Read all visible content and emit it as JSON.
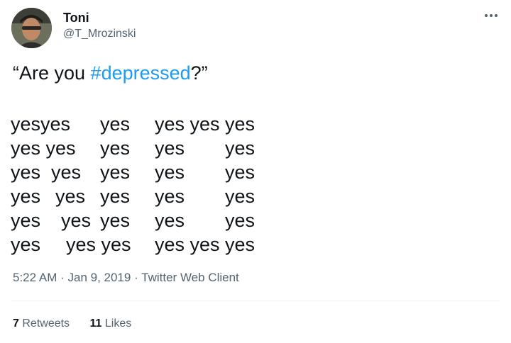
{
  "author": {
    "display_name": "Toni",
    "handle": "@T_Mrozinski"
  },
  "tweet": {
    "quote_open": "“Are you ",
    "hashtag": "#depressed",
    "quote_close": "?”",
    "yes_word": "yes",
    "rows": [
      [
        "yesyes",
        "yes",
        "yes yes yes"
      ],
      [
        "yes yes",
        "yes",
        "yes",
        "yes"
      ],
      [
        "yes  yes",
        "yes",
        "yes",
        "yes"
      ],
      [
        "yes",
        "yes",
        "yes",
        "yes",
        "yes"
      ],
      [
        "yes",
        "yes",
        "yes",
        "yes",
        "yes"
      ],
      [
        "yes",
        "yes yes",
        "yes yes yes"
      ]
    ]
  },
  "meta": {
    "time": "5:22 AM",
    "separator": " · ",
    "date": "Jan 9, 2019",
    "client": "Twitter Web Client"
  },
  "stats": {
    "retweets_count": "7",
    "retweets_label": "Retweets",
    "likes_count": "11",
    "likes_label": "Likes"
  },
  "icons": {
    "more": "more-horizontal-icon"
  },
  "colors": {
    "hashtag": "#1d9bf0",
    "secondary_text": "#536471",
    "primary_text": "#0f1419"
  }
}
